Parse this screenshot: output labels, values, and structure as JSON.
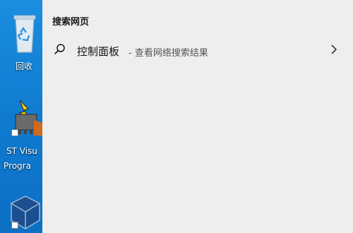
{
  "desktop": {
    "icons": [
      {
        "label": "回收",
        "icon": "recycle-bin-icon"
      },
      {
        "label": "ST Visu",
        "label2": "Progra",
        "icon": "st-visual-programmer-icon"
      },
      {
        "label": "",
        "icon": "virtualbox-icon"
      }
    ]
  },
  "search": {
    "section_title": "搜索网页",
    "result": {
      "title": "控制面板",
      "subtitle": "- 查看网络搜索结果"
    }
  },
  "colors": {
    "panel_bg": "#eeeeee",
    "desktop_bg": "#0f7bd0"
  }
}
